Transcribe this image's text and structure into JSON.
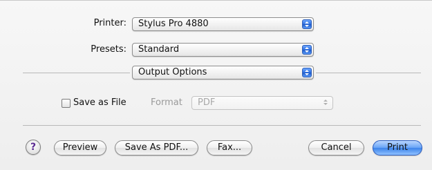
{
  "printer": {
    "label": "Printer:",
    "value": "Stylus Pro 4880"
  },
  "presets": {
    "label": "Presets:",
    "value": "Standard"
  },
  "panel": {
    "value": "Output Options"
  },
  "output": {
    "save_as_file_label": "Save as File",
    "save_as_file_checked": false,
    "format_label": "Format",
    "format_value": "PDF"
  },
  "buttons": {
    "help": "?",
    "preview": "Preview",
    "save_as_pdf": "Save As PDF...",
    "fax": "Fax...",
    "cancel": "Cancel",
    "print": "Print"
  },
  "colors": {
    "accent": "#3d84ea",
    "help_glyph": "#5b2a92"
  }
}
